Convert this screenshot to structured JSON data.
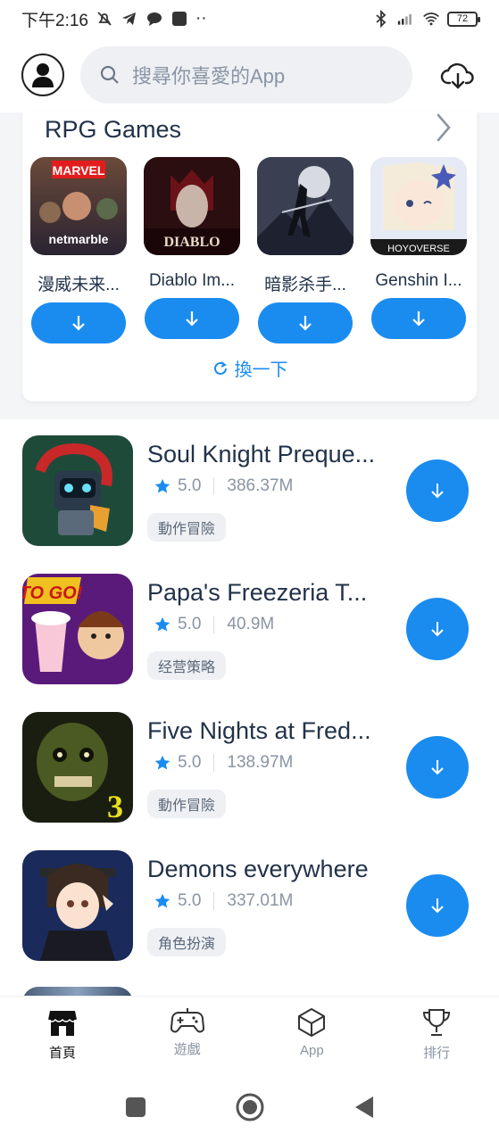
{
  "status_bar": {
    "time": "下午2:16",
    "battery": "72"
  },
  "search": {
    "placeholder": "搜尋你喜愛的App"
  },
  "rpg_section": {
    "title": "RPG Games",
    "refresh_label": "換一下",
    "items": [
      {
        "name": "漫威未来...",
        "logo_text": "netmarble",
        "brand_text": "MARVEL"
      },
      {
        "name": "Diablo Im...",
        "logo_text": "DIABLO"
      },
      {
        "name": "暗影杀手..."
      },
      {
        "name": "Genshin I...",
        "logo_text": "HOYOVERSE"
      }
    ]
  },
  "apps": [
    {
      "name": "Soul Knight Preque...",
      "rating": "5.0",
      "size": "386.37M",
      "tag": "動作冒險"
    },
    {
      "name": "Papa's Freezeria T...",
      "rating": "5.0",
      "size": "40.9M",
      "tag": "经营策略",
      "logo_text": "TO GO!"
    },
    {
      "name": "Five Nights at Fred...",
      "rating": "5.0",
      "size": "138.97M",
      "tag": "動作冒險",
      "logo_text": "3"
    },
    {
      "name": "Demons everywhere",
      "rating": "5.0",
      "size": "337.01M",
      "tag": "角色扮演"
    }
  ],
  "bottom_nav": [
    {
      "label": "首頁",
      "icon": "store-icon",
      "active": true
    },
    {
      "label": "遊戲",
      "icon": "gamepad-icon"
    },
    {
      "label": "App",
      "icon": "cube-icon"
    },
    {
      "label": "排行",
      "icon": "trophy-icon"
    }
  ],
  "colors": {
    "accent": "#1a8cf0",
    "star": "#1a8cf0"
  }
}
